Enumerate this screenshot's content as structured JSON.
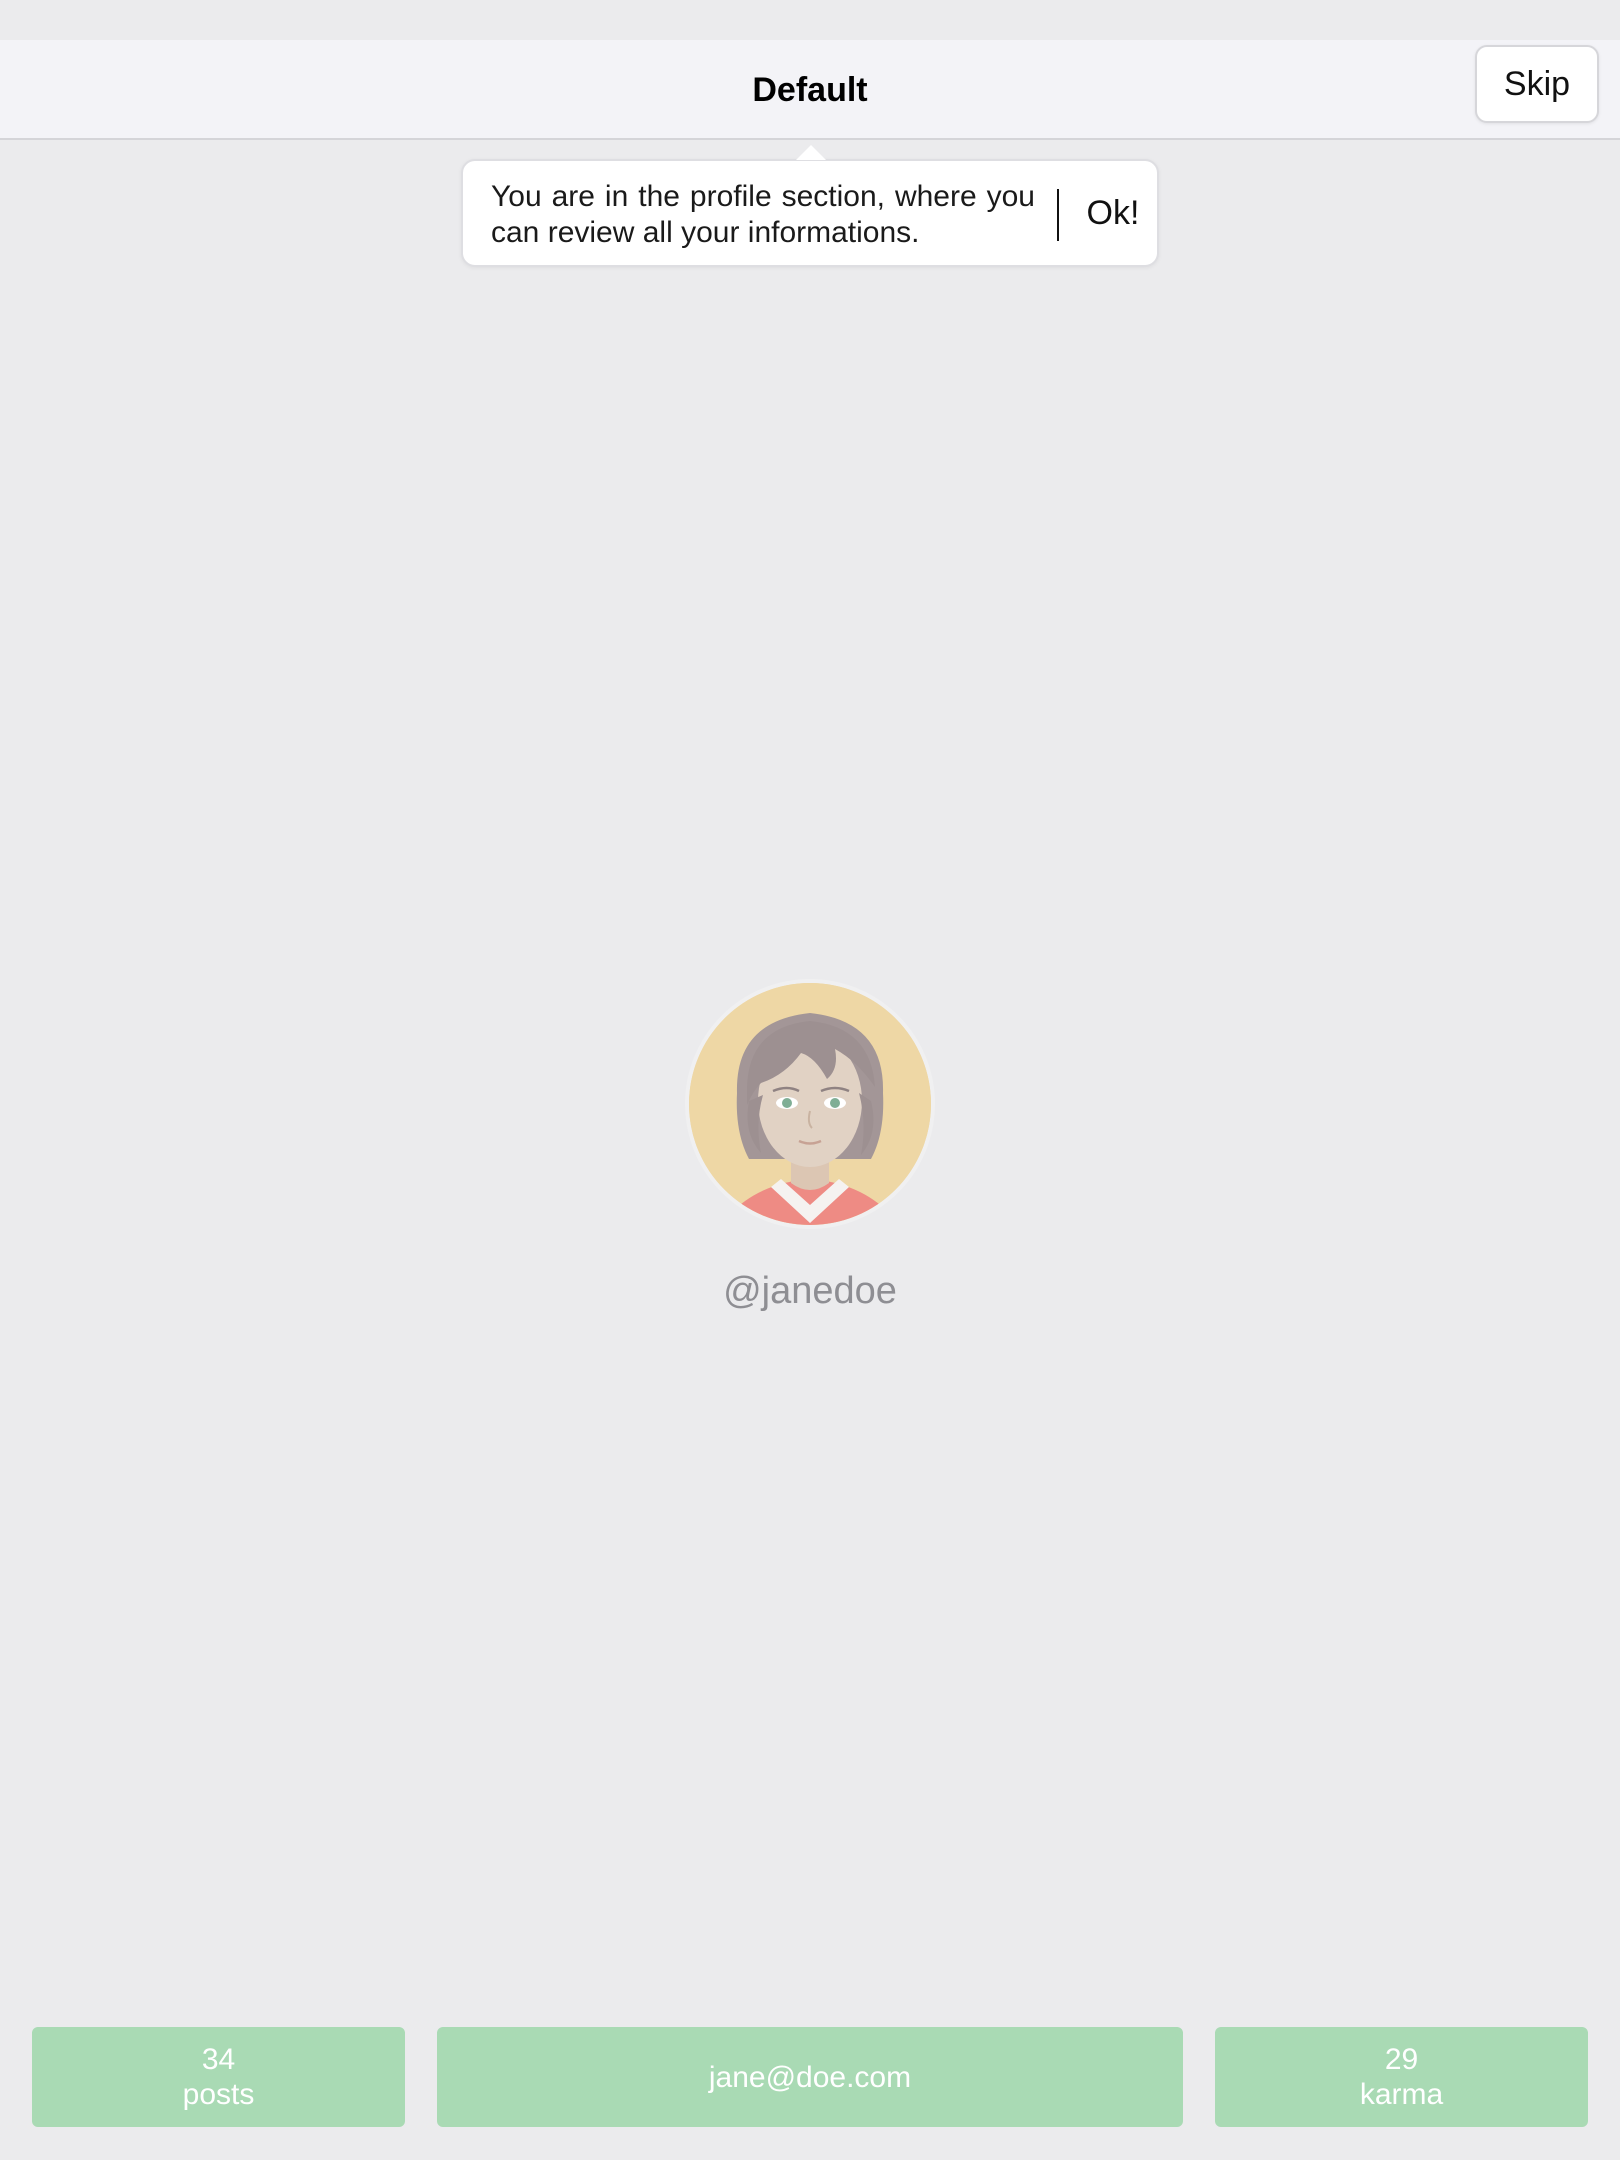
{
  "nav": {
    "title": "Default",
    "skip_label": "Skip"
  },
  "tooltip": {
    "text": "You are in the profile section, where you can review all your informations.",
    "ok_label": "Ok!"
  },
  "profile": {
    "avatar_icon": "female-avatar-icon",
    "username": "@janedoe"
  },
  "stats": {
    "posts": {
      "value": "34",
      "label": "posts"
    },
    "email": "jane@doe.com",
    "karma": {
      "value": "29",
      "label": "karma"
    }
  },
  "colors": {
    "background": "#ebebed",
    "nav_background": "#f3f3f7",
    "stat_box": "#a9dab4",
    "username_text": "#8e8e93"
  }
}
